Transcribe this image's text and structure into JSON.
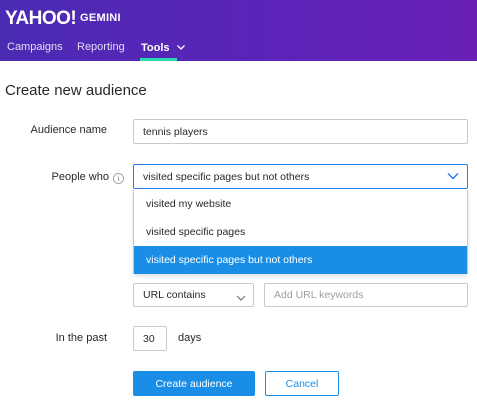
{
  "header": {
    "logo": "YAHOO!",
    "product": "GEMINI",
    "nav": [
      {
        "label": "Campaigns"
      },
      {
        "label": "Reporting"
      },
      {
        "label": "Tools"
      }
    ]
  },
  "page": {
    "title": "Create new audience"
  },
  "form": {
    "audience_name_label": "Audience name",
    "audience_name_value": "tennis players",
    "people_who_label": "People who",
    "people_who_selected": "visited specific pages but not others",
    "people_who_options": [
      "visited my website",
      "visited specific pages",
      "visited specific pages but not others"
    ],
    "url_rule_selected": "URL contains",
    "url_keywords_placeholder": "Add URL keywords",
    "in_the_past_label": "In the past",
    "in_the_past_value": "30",
    "days_label": "days"
  },
  "actions": {
    "create_label": "Create audience",
    "cancel_label": "Cancel"
  },
  "colors": {
    "header_gradient_start": "#4b2bb3",
    "header_gradient_end": "#6a1fb5",
    "nav_accent": "#2bd9b0",
    "primary_blue": "#1a8ee6"
  }
}
